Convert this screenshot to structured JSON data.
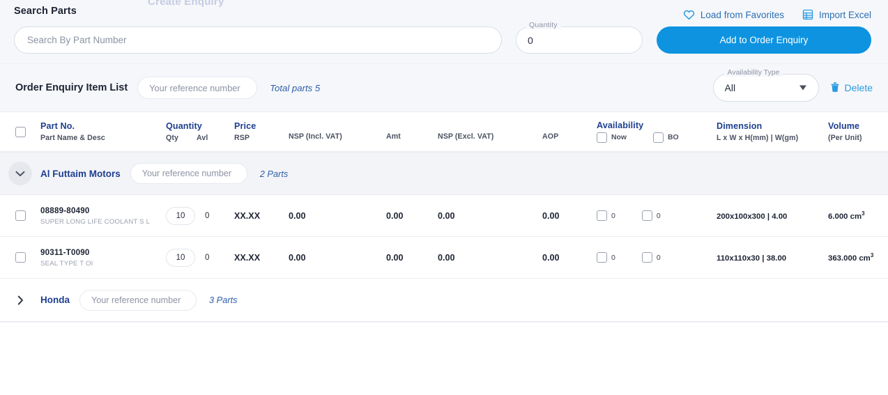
{
  "header": {
    "cut_title": "Create Enquiry",
    "search_label": "Search Parts",
    "search_placeholder": "Search By Part Number",
    "quantity_label": "Quantity",
    "quantity_value": "0",
    "load_favorites_label": "Load from Favorites",
    "import_excel_label": "Import Excel",
    "add_button_label": "Add to Order Enquiry",
    "accent_color": "#0d93e0",
    "link_color": "#2a6fb0"
  },
  "toolbar": {
    "title": "Order Enquiry Item List",
    "reference_placeholder": "Your reference number",
    "reference_value": "",
    "total_parts": "Total parts 5",
    "availability_type_label": "Availability Type",
    "availability_type_value": "All",
    "availability_type_options": [
      "All"
    ],
    "delete_label": "Delete"
  },
  "table": {
    "columns": {
      "part_no": {
        "main": "Part No.",
        "sub": "Part Name & Desc"
      },
      "quantity": {
        "main": "Quantity",
        "sub_qty": "Qty",
        "sub_avl": "Avl"
      },
      "price": {
        "main": "Price",
        "sub": "RSP"
      },
      "nsp_incl_vat": "NSP (Incl. VAT)",
      "amt": "Amt",
      "nsp_excl_vat": "NSP (Excl. VAT)",
      "aop": "AOP",
      "availability": {
        "main": "Availability",
        "sub_now": "Now",
        "sub_bo": "BO"
      },
      "dimension": {
        "main": "Dimension",
        "sub": "L x W x H(mm) | W(gm)"
      },
      "volume": {
        "main": "Volume",
        "sub": "(Per Unit)"
      }
    },
    "groups": [
      {
        "name": "Al Futtaim Motors",
        "expanded": true,
        "reference_placeholder": "Your reference number",
        "reference_value": "",
        "parts_count_label": "2 Parts",
        "rows": [
          {
            "part_no": "08889-80490",
            "part_desc": "SUPER LONG LIFE COOLANT S L",
            "qty": "10",
            "avl": "0",
            "price_rsp": "XX.XX",
            "nsp_incl_vat": "0.00",
            "amt": "0.00",
            "nsp_excl_vat": "0.00",
            "aop": "0.00",
            "avail_now": "0",
            "avail_bo": "0",
            "dimension": "200x100x300 | 4.00",
            "volume": "6.000 cm",
            "volume_sup": "3"
          },
          {
            "part_no": "90311-T0090",
            "part_desc": "SEAL TYPE T OI",
            "qty": "10",
            "avl": "0",
            "price_rsp": "XX.XX",
            "nsp_incl_vat": "0.00",
            "amt": "0.00",
            "nsp_excl_vat": "0.00",
            "aop": "0.00",
            "avail_now": "0",
            "avail_bo": "0",
            "dimension": "110x110x30 | 38.00",
            "volume": "363.000 cm",
            "volume_sup": "3"
          }
        ]
      },
      {
        "name": "Honda",
        "expanded": false,
        "reference_placeholder": "Your reference number",
        "reference_value": "",
        "parts_count_label": "3 Parts",
        "rows": []
      }
    ]
  }
}
